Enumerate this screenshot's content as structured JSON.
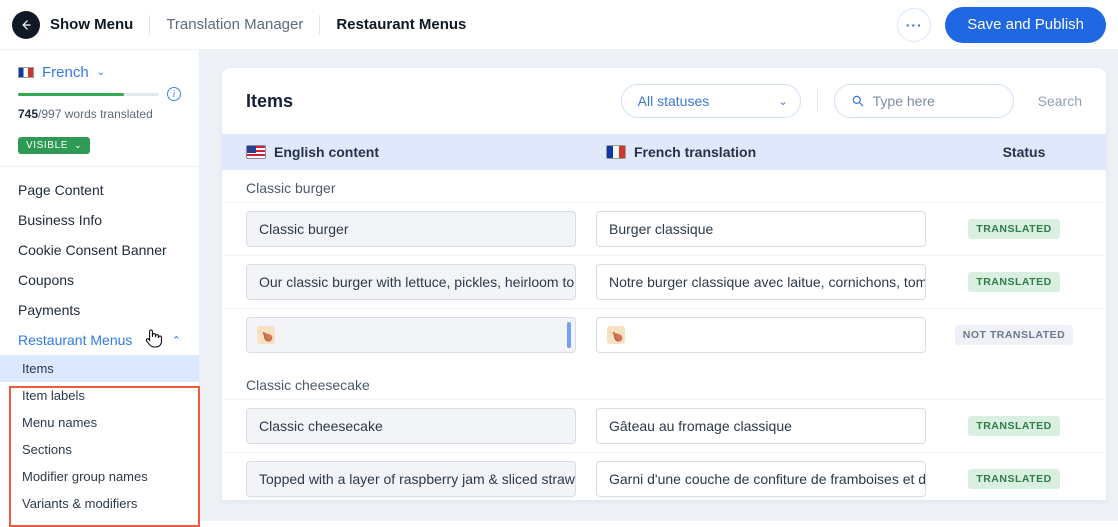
{
  "topbar": {
    "show_menu": "Show Menu",
    "crumb1": "Translation Manager",
    "crumb2": "Restaurant Menus",
    "save": "Save and Publish"
  },
  "sidebar": {
    "language": "French",
    "words_done": "745",
    "words_sep": "/",
    "words_total": "997 words translated",
    "visible": "VISIBLE",
    "nav": {
      "page_content": "Page Content",
      "business_info": "Business Info",
      "cookie": "Cookie Consent Banner",
      "coupons": "Coupons",
      "payments": "Payments"
    },
    "menus": {
      "head": "Restaurant Menus",
      "items": "Items",
      "item_labels": "Item labels",
      "menu_names": "Menu names",
      "sections": "Sections",
      "modifier_groups": "Modifier group names",
      "variants": "Variants & modifiers"
    }
  },
  "panel": {
    "title": "Items",
    "filter": "All statuses",
    "search_ph": "Type here",
    "search_btn": "Search",
    "col_eng": "English content",
    "col_fr": "French translation",
    "col_status": "Status",
    "status_translated": "TRANSLATED",
    "status_not": "NOT TRANSLATED",
    "groups": {
      "g1": "Classic burger",
      "g2": "Classic cheesecake"
    },
    "rows": {
      "r1_src": "Classic burger",
      "r1_dst": "Burger classique",
      "r2_src": "Our classic burger with lettuce, pickles, heirloom to…",
      "r2_dst": "Notre burger classique avec laitue, cornichons, tom…",
      "r4_src": "Classic cheesecake",
      "r4_dst": "Gâteau au fromage classique",
      "r5_src": "Topped with a layer of raspberry jam & sliced straw…",
      "r5_dst": "Garni d'une couche de confiture de framboises et d…"
    }
  }
}
